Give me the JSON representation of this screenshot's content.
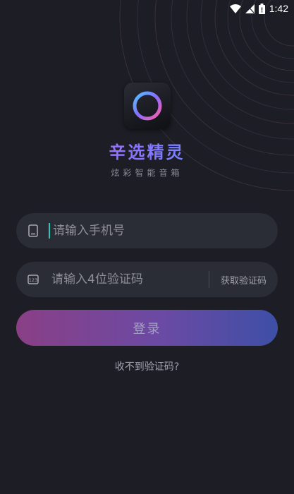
{
  "status_bar": {
    "time": "1:42",
    "battery_level": "!",
    "icons": [
      "wifi-icon",
      "signal-icon",
      "battery-icon"
    ]
  },
  "app": {
    "title": "辛选精灵",
    "subtitle": "炫彩智能音箱",
    "colors": {
      "accent_pink": "#d86fd6",
      "accent_purple": "#8b73ff",
      "accent_blue": "#4fa3ff"
    }
  },
  "form": {
    "phone": {
      "value": "",
      "placeholder": "请输入手机号",
      "icon": "phone-icon"
    },
    "code": {
      "value": "",
      "placeholder": "请输入4位验证码",
      "icon": "keypad-icon",
      "get_code_label": "获取验证码"
    },
    "login_label": "登录",
    "no_code_link": "收不到验证码?"
  },
  "colors": {
    "background": "#1c1d25",
    "field_background": "#2a2c36",
    "caret": "#29c6b9",
    "button_gradient_start": "#8a3f86",
    "button_gradient_end": "#3e4fa6"
  }
}
